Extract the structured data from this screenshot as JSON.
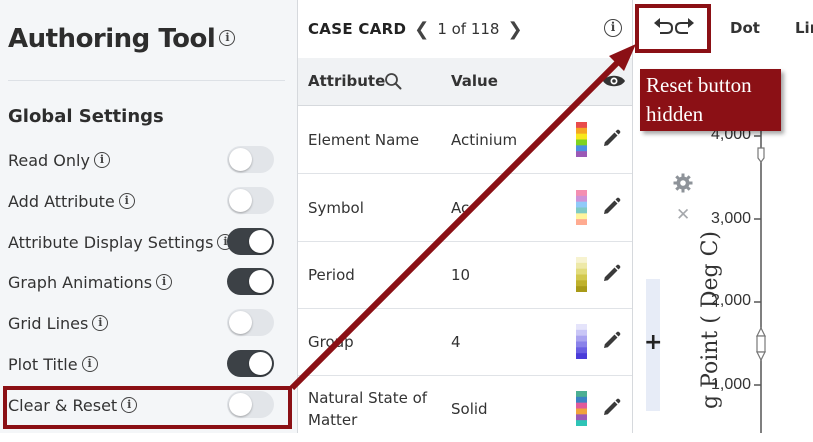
{
  "app": {
    "title": "Authoring Tool"
  },
  "global_settings": {
    "title": "Global Settings",
    "items": [
      {
        "label": "Read Only",
        "on": false
      },
      {
        "label": "Add Attribute",
        "on": false
      },
      {
        "label": "Attribute Display Settings",
        "on": true
      },
      {
        "label": "Graph Animations",
        "on": true
      },
      {
        "label": "Grid Lines",
        "on": false
      },
      {
        "label": "Plot Title",
        "on": true
      },
      {
        "label": "Clear & Reset",
        "on": false
      }
    ]
  },
  "case_card": {
    "title": "CASE CARD",
    "position": "1 of 118",
    "columns": {
      "attribute": "Attribute",
      "value": "Value"
    },
    "rows": [
      {
        "attribute": "Element Name",
        "value": "Actinium",
        "swatch": [
          "#e94b4b",
          "#f5a623",
          "#f8e71c",
          "#7ed321",
          "#4a90e2",
          "#9b59b6"
        ]
      },
      {
        "attribute": "Symbol",
        "value": "Ac",
        "swatch": [
          "#f48fb1",
          "#ce93d8",
          "#90caf9",
          "#80cbc4",
          "#fff59d",
          "#ffab91"
        ]
      },
      {
        "attribute": "Period",
        "value": "10",
        "swatch": [
          "#f7f3d0",
          "#eee9a8",
          "#e2dc7c",
          "#d2c84e",
          "#bfb12c",
          "#a89a18"
        ]
      },
      {
        "attribute": "Group",
        "value": "4",
        "swatch": [
          "#e5e4fb",
          "#c9c6f6",
          "#aaa4f0",
          "#8a82ea",
          "#6a5fe3",
          "#4a3cd9"
        ]
      },
      {
        "attribute": "Natural State of Matter",
        "value": "Solid",
        "swatch": [
          "#4caf93",
          "#3b82c4",
          "#e05a9b",
          "#f0a33b",
          "#9b59b6",
          "#2ec4b6"
        ]
      }
    ]
  },
  "graph": {
    "tabs": [
      "Dot",
      "Lin"
    ],
    "y_axis_label": "g Point ( Deg C)",
    "y_ticks": [
      "4,000",
      "3,000",
      "2,000",
      "1,000"
    ]
  },
  "annotation": {
    "callout_text": "Reset button hidden",
    "color": "#8b1015"
  },
  "colors": {
    "toggle_on": "#3c4146",
    "toggle_off": "#e2e5e9",
    "panel_bg": "#f4f6f8"
  },
  "icons": [
    "info-icon",
    "chevron-left-icon",
    "chevron-right-icon",
    "search-icon",
    "eye-icon",
    "color-swatch-icon",
    "pencil-icon",
    "undo-icon",
    "redo-icon",
    "gear-icon",
    "close-icon",
    "plus-icon"
  ]
}
